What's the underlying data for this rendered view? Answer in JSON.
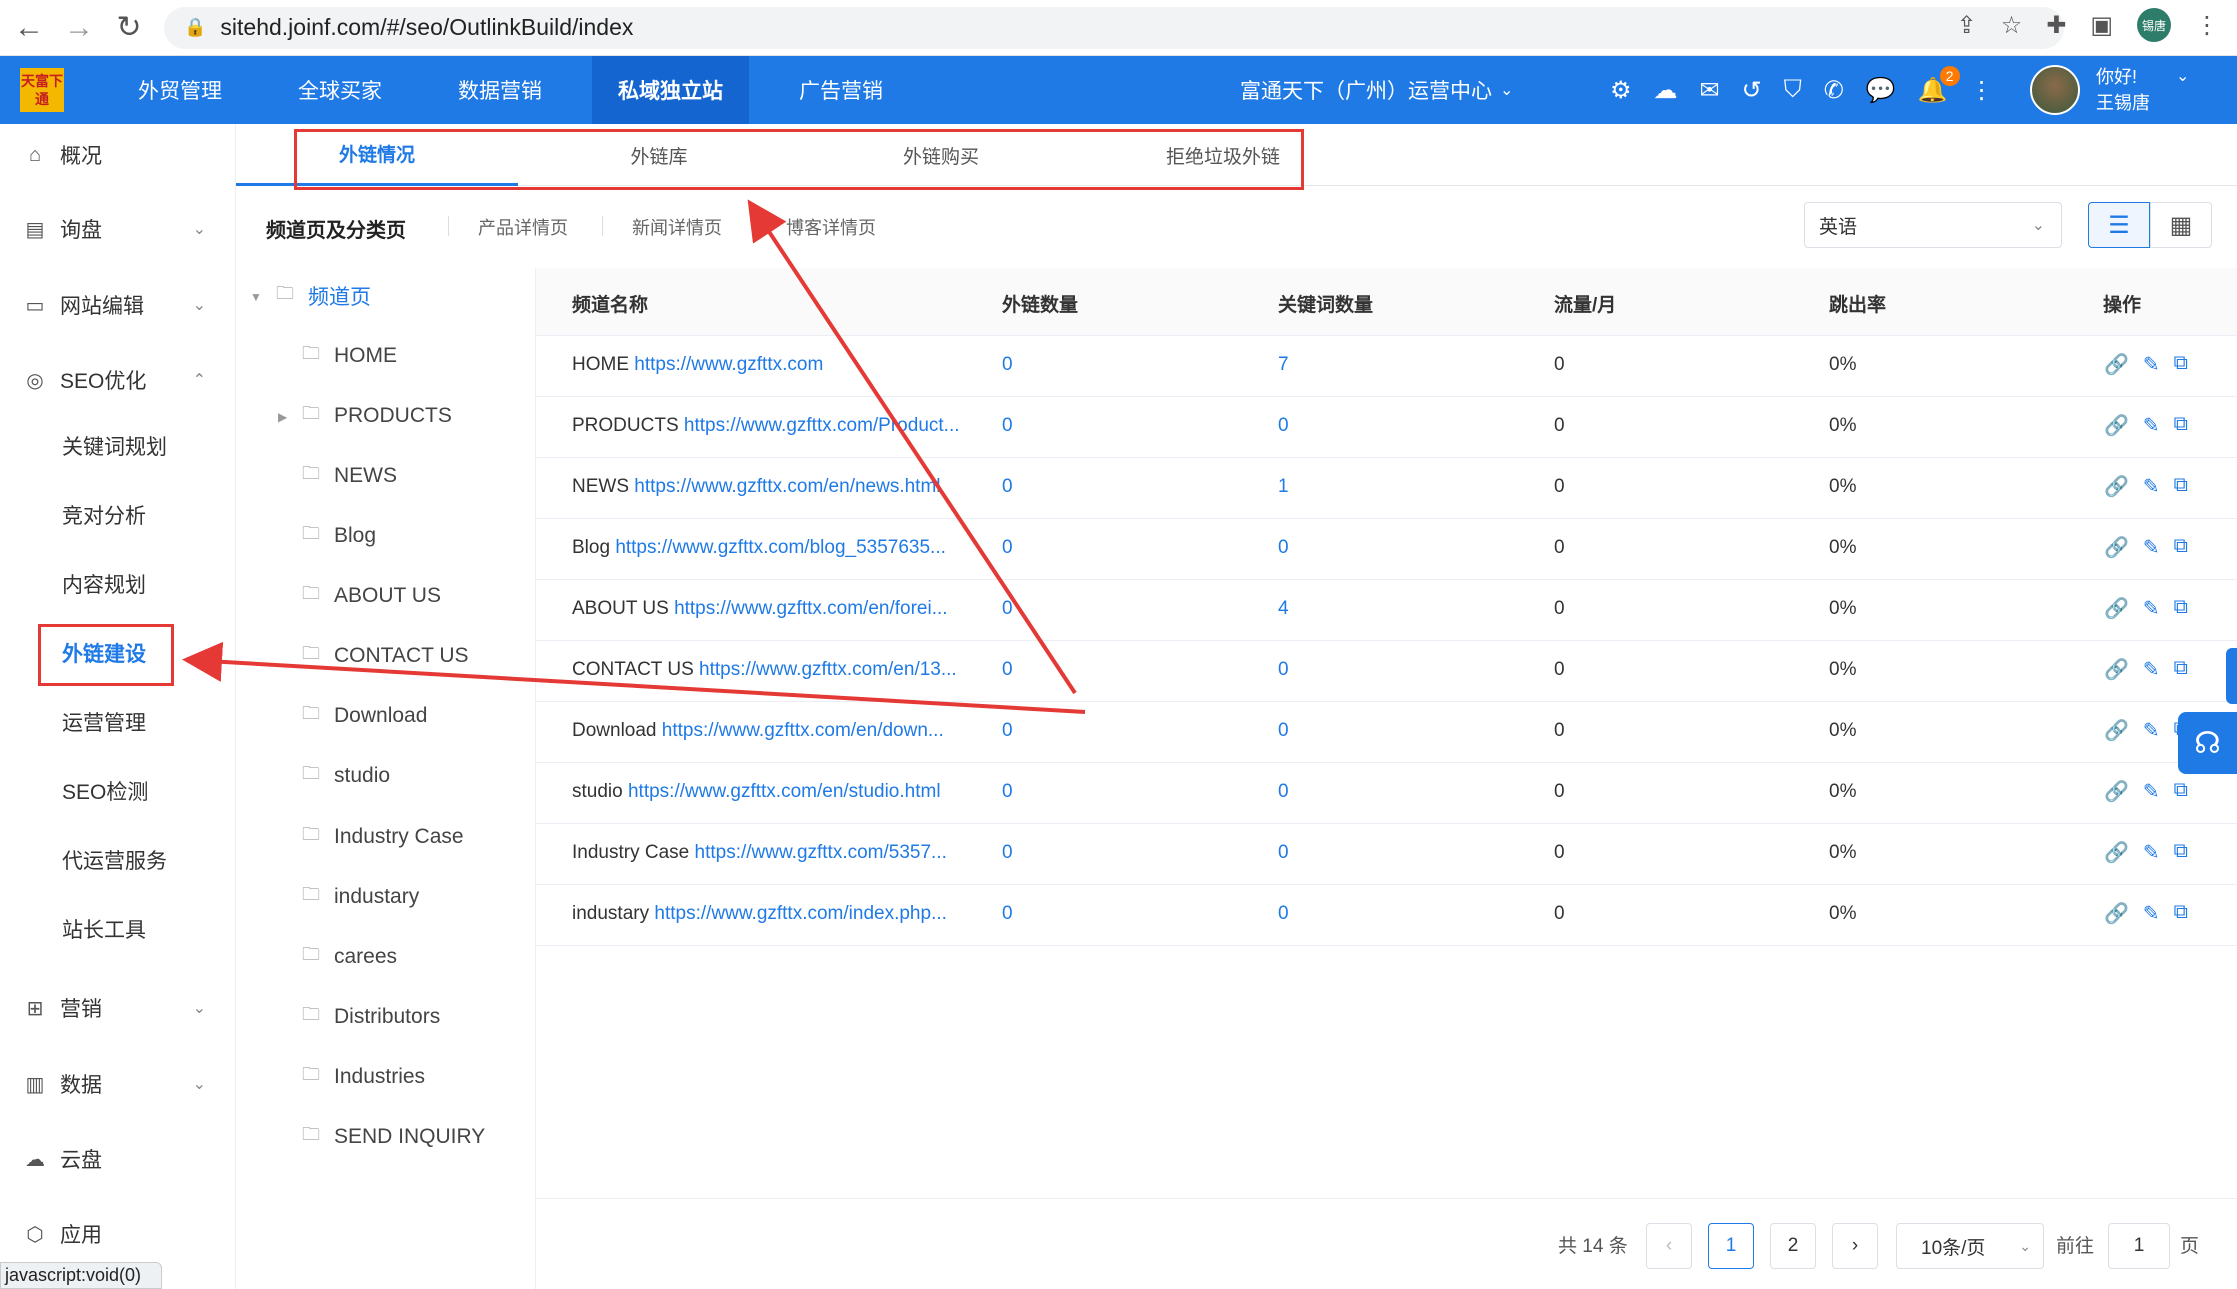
{
  "browser": {
    "url": "sitehd.joinf.com/#/seo/OutlinkBuild/index",
    "profile_initials": "锡唐"
  },
  "header": {
    "logo_text": "天富下通",
    "nav": [
      "外贸管理",
      "全球买家",
      "数据营销",
      "私域独立站",
      "广告营销"
    ],
    "active_nav": "私域独立站",
    "org": "富通天下（广州）运营中心",
    "notif_count": "2",
    "greeting": "你好!",
    "username": "王锡唐"
  },
  "sidebar": {
    "items": [
      {
        "label": "概况",
        "icon": "home-icon"
      },
      {
        "label": "询盘",
        "icon": "inquiry-icon"
      },
      {
        "label": "网站编辑",
        "icon": "monitor-icon"
      },
      {
        "label": "SEO优化",
        "icon": "seo-icon"
      },
      {
        "label": "营销",
        "icon": "marketing-icon"
      },
      {
        "label": "数据",
        "icon": "chart-icon"
      },
      {
        "label": "云盘",
        "icon": "cloud-icon"
      },
      {
        "label": "应用",
        "icon": "app-icon"
      }
    ],
    "seo_sub": [
      "关键词规划",
      "竞对分析",
      "内容规划",
      "外链建设",
      "运营管理",
      "SEO检测",
      "代运营服务",
      "站长工具"
    ],
    "active_sub": "外链建设"
  },
  "status_bar": "javascript:void(0)",
  "tabs": [
    "外链情况",
    "外链库",
    "外链购买",
    "拒绝垃圾外链"
  ],
  "subtabs": [
    "频道页及分类页",
    "产品详情页",
    "新闻详情页",
    "博客详情页"
  ],
  "language": "英语",
  "tree": {
    "root": "频道页",
    "children": [
      "HOME",
      "PRODUCTS",
      "NEWS",
      "Blog",
      "ABOUT US",
      "CONTACT US",
      "Download",
      "studio",
      "Industry Case",
      "industary",
      "carees",
      "Distributors",
      "Industries",
      "SEND INQUIRY"
    ]
  },
  "table": {
    "headers": [
      "频道名称",
      "外链数量",
      "关键词数量",
      "流量/月",
      "跳出率",
      "操作"
    ],
    "rows": [
      {
        "name": "HOME",
        "url": "https://www.gzfttx.com",
        "links": "0",
        "keywords": "7",
        "traffic": "0",
        "bounce": "0%"
      },
      {
        "name": "PRODUCTS",
        "url": "https://www.gzfttx.com/Product...",
        "links": "0",
        "keywords": "0",
        "traffic": "0",
        "bounce": "0%"
      },
      {
        "name": "NEWS",
        "url": "https://www.gzfttx.com/en/news.html",
        "links": "0",
        "keywords": "1",
        "traffic": "0",
        "bounce": "0%"
      },
      {
        "name": "Blog",
        "url": "https://www.gzfttx.com/blog_5357635...",
        "links": "0",
        "keywords": "0",
        "traffic": "0",
        "bounce": "0%"
      },
      {
        "name": "ABOUT US",
        "url": "https://www.gzfttx.com/en/forei...",
        "links": "0",
        "keywords": "4",
        "traffic": "0",
        "bounce": "0%"
      },
      {
        "name": "CONTACT US",
        "url": "https://www.gzfttx.com/en/13...",
        "links": "0",
        "keywords": "0",
        "traffic": "0",
        "bounce": "0%"
      },
      {
        "name": "Download",
        "url": "https://www.gzfttx.com/en/down...",
        "links": "0",
        "keywords": "0",
        "traffic": "0",
        "bounce": "0%"
      },
      {
        "name": "studio",
        "url": "https://www.gzfttx.com/en/studio.html",
        "links": "0",
        "keywords": "0",
        "traffic": "0",
        "bounce": "0%"
      },
      {
        "name": "Industry Case",
        "url": "https://www.gzfttx.com/5357...",
        "links": "0",
        "keywords": "0",
        "traffic": "0",
        "bounce": "0%"
      },
      {
        "name": "industary",
        "url": "https://www.gzfttx.com/index.php...",
        "links": "0",
        "keywords": "0",
        "traffic": "0",
        "bounce": "0%"
      }
    ]
  },
  "pagination": {
    "total": "共 14 条",
    "pages": [
      "1",
      "2"
    ],
    "current": "1",
    "page_size": "10条/页",
    "goto_label": "前往",
    "goto_value": "1",
    "page_unit": "页",
    "prev_icon": "‹",
    "next_icon": "›"
  },
  "annotation_color": "#e53935"
}
